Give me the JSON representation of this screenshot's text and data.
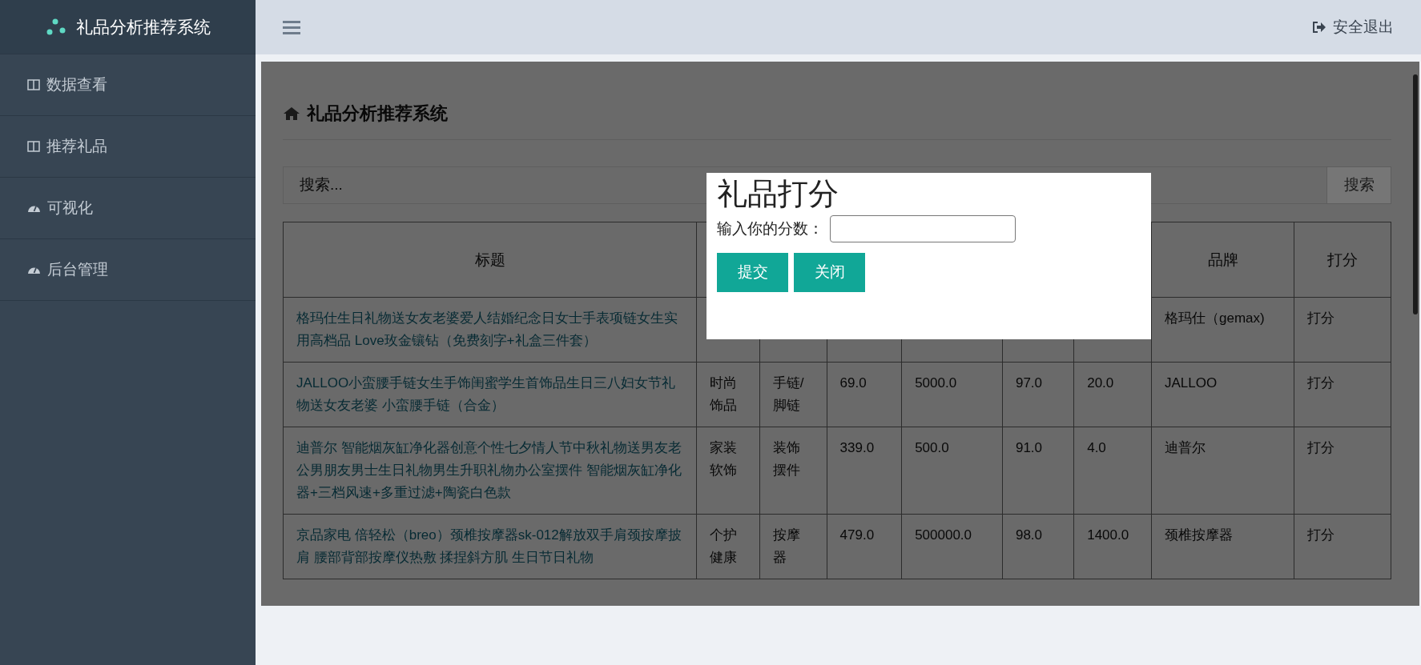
{
  "sidebar": {
    "title": "礼品分析推荐系统",
    "items": [
      {
        "label": "数据查看",
        "kind": "columns"
      },
      {
        "label": "推荐礼品",
        "kind": "columns"
      },
      {
        "label": "可视化",
        "kind": "dashboard"
      },
      {
        "label": "后台管理",
        "kind": "dashboard"
      }
    ]
  },
  "topbar": {
    "logout": "安全退出"
  },
  "panel": {
    "title": "礼品分析推荐系统",
    "search": {
      "placeholder": "搜索...",
      "button": "搜索"
    },
    "table": {
      "header": {
        "title": "标题",
        "brand": "品牌",
        "action": "打分"
      },
      "rows": [
        {
          "title": "格玛仕生日礼物送女友老婆爱人结婚纪念日女士手表项链女生实用高档品 Love玫金镶钻（免费刻字+礼盒三件套）",
          "brand": "格玛仕（gemax)",
          "action": "打分"
        },
        {
          "title": "JALLOO小蛮腰手链女生手饰闺蜜学生首饰品生日三八妇女节礼物送女友老婆 小蛮腰手链（合金）",
          "category": "时尚饰品",
          "subcategory": "手链/脚链",
          "price": "69.0",
          "sales": "5000.0",
          "score": "97.0",
          "comments": "20.0",
          "brand": "JALLOO",
          "action": "打分"
        },
        {
          "title": "迪普尔 智能烟灰缸净化器创意个性七夕情人节中秋礼物送男友老公男朋友男士生日礼物男生升职礼物办公室摆件 智能烟灰缸净化器+三档风速+多重过滤+陶瓷白色款",
          "category": "家装软饰",
          "subcategory": "装饰摆件",
          "price": "339.0",
          "sales": "500.0",
          "score": "91.0",
          "comments": "4.0",
          "brand": "迪普尔",
          "action": "打分"
        },
        {
          "title": "京品家电 倍轻松（breo）颈椎按摩器sk-012解放双手肩颈按摩披肩 腰部背部按摩仪热敷 揉捏斜方肌 生日节日礼物",
          "category": "个护健康",
          "subcategory": "按摩器",
          "price": "479.0",
          "sales": "500000.0",
          "score": "98.0",
          "comments": "1400.0",
          "brand": "颈椎按摩器",
          "action": "打分"
        }
      ]
    }
  },
  "modal": {
    "title": "礼品打分",
    "label": "输入你的分数：",
    "buttons": [
      "提交",
      "关闭"
    ]
  }
}
